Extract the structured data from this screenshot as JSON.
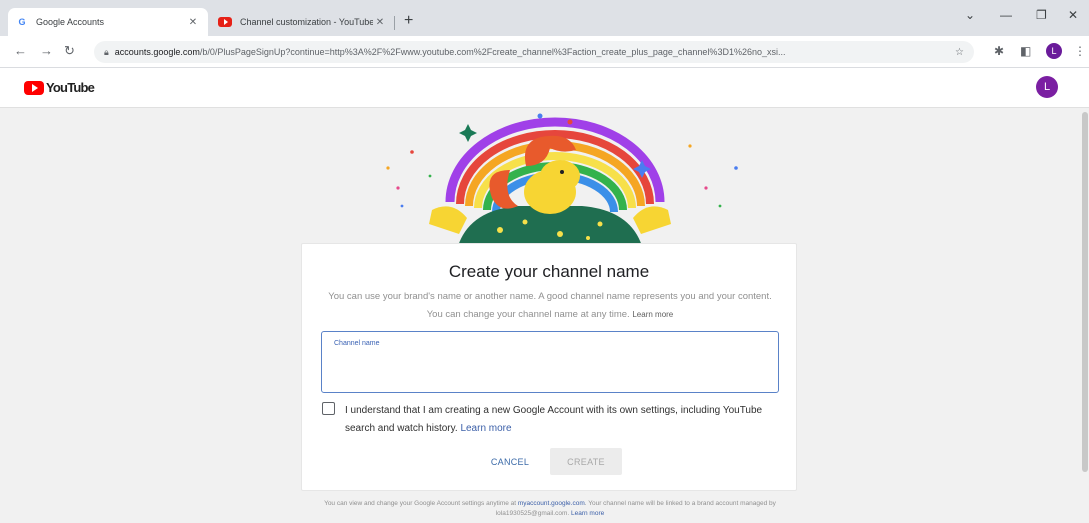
{
  "browser": {
    "tabs": [
      {
        "title": "Google Accounts",
        "favicon": "google-g-icon",
        "active": true
      },
      {
        "title": "Channel customization - YouTube",
        "favicon": "youtube-icon",
        "active": false
      }
    ],
    "new_tab": "+",
    "url_domain": "accounts.google.com",
    "url_rest": "/b/0/PlusPageSignUp?continue=http%3A%2F%2Fwww.youtube.com%2Fcreate_channel%3Faction_create_plus_page_channel%3D1%26no_xsi..."
  },
  "header": {
    "logo_text": "YouTube",
    "avatar_letter": "L",
    "colors": {
      "brand_red": "#ff0000",
      "avatar": "#7b1fa2"
    }
  },
  "card": {
    "title": "Create your channel name",
    "description": "You can use your brand's name or another name. A good channel name represents you and your content. You can change your channel name at any time.",
    "learn_more_small": "Learn more",
    "field_label": "Channel name",
    "field_value": "",
    "checkbox_checked": false,
    "checkbox_text": "I understand that I am creating a new Google Account with its own settings, including YouTube search and watch history.",
    "checkbox_link": "Learn more",
    "cancel_label": "CANCEL",
    "create_label": "CREATE"
  },
  "footer": {
    "text_before": "You can view and change your Google Account settings anytime at",
    "link": "myaccount.google.com",
    "text_after": "Your channel name will be linked to a brand account managed by",
    "email": "lola1930525@gmail.com",
    "learn_more": "Learn more"
  }
}
